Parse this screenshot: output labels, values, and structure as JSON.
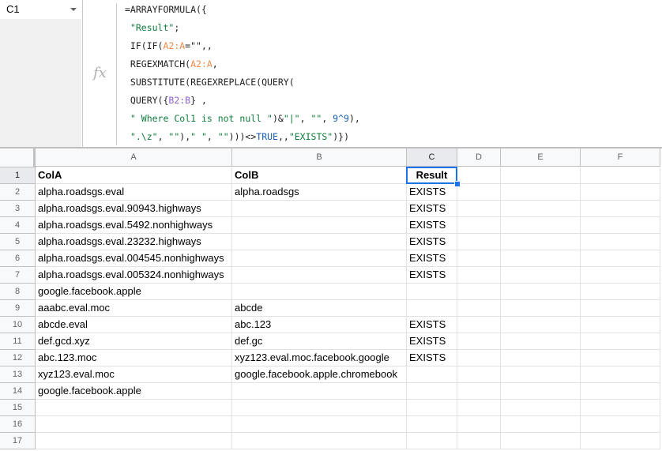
{
  "name_box": {
    "value": "C1"
  },
  "formula_bar": {
    "icon": "fx-icon",
    "lines": [
      [
        {
          "t": "=ARRAYFORMULA({",
          "c": ""
        }
      ],
      [
        {
          "t": " ",
          "c": ""
        },
        {
          "t": "\"Result\"",
          "c": "str"
        },
        {
          "t": ";",
          "c": ""
        }
      ],
      [
        {
          "t": " IF(IF(",
          "c": ""
        },
        {
          "t": "A2:A",
          "c": "ref-a"
        },
        {
          "t": "=\"\",,",
          "c": ""
        }
      ],
      [
        {
          "t": " REGEXMATCH(",
          "c": ""
        },
        {
          "t": "A2:A",
          "c": "ref-a"
        },
        {
          "t": ",",
          "c": ""
        }
      ],
      [
        {
          "t": " SUBSTITUTE(REGEXREPLACE(QUERY(",
          "c": ""
        }
      ],
      [
        {
          "t": " QUERY({",
          "c": ""
        },
        {
          "t": "B2:B",
          "c": "ref-b"
        },
        {
          "t": "} ,",
          "c": ""
        }
      ],
      [
        {
          "t": " ",
          "c": ""
        },
        {
          "t": "\" Where Col1 is not null \"",
          "c": "str"
        },
        {
          "t": ")&",
          "c": ""
        },
        {
          "t": "\"|\"",
          "c": "str"
        },
        {
          "t": ", ",
          "c": ""
        },
        {
          "t": "\"\"",
          "c": "str"
        },
        {
          "t": ", ",
          "c": ""
        },
        {
          "t": "9^9",
          "c": "num"
        },
        {
          "t": "),",
          "c": ""
        }
      ],
      [
        {
          "t": " ",
          "c": ""
        },
        {
          "t": "\".\\z\"",
          "c": "str"
        },
        {
          "t": ", ",
          "c": ""
        },
        {
          "t": "\"\"",
          "c": "str"
        },
        {
          "t": "),",
          "c": ""
        },
        {
          "t": "\" \"",
          "c": "str"
        },
        {
          "t": ", ",
          "c": ""
        },
        {
          "t": "\"\"",
          "c": "str"
        },
        {
          "t": ")))<>",
          "c": ""
        },
        {
          "t": "TRUE",
          "c": "bool"
        },
        {
          "t": ",,",
          "c": ""
        },
        {
          "t": "\"EXISTS\"",
          "c": "str"
        },
        {
          "t": ")})",
          "c": ""
        }
      ]
    ]
  },
  "columns": [
    "A",
    "B",
    "C",
    "D",
    "E",
    "F"
  ],
  "selected_cell": {
    "col": "C",
    "row": 1
  },
  "rows": [
    {
      "n": "1",
      "A": "ColA",
      "B": "ColB",
      "C": "Result"
    },
    {
      "n": "2",
      "A": "alpha.roadsgs.eval",
      "B": "alpha.roadsgs",
      "C": "EXISTS"
    },
    {
      "n": "3",
      "A": "alpha.roadsgs.eval.90943.highways",
      "B": "",
      "C": "EXISTS"
    },
    {
      "n": "4",
      "A": "alpha.roadsgs.eval.5492.nonhighways",
      "B": "",
      "C": "EXISTS"
    },
    {
      "n": "5",
      "A": "alpha.roadsgs.eval.23232.highways",
      "B": "",
      "C": "EXISTS"
    },
    {
      "n": "6",
      "A": "alpha.roadsgs.eval.004545.nonhighways",
      "B": "",
      "C": "EXISTS"
    },
    {
      "n": "7",
      "A": "alpha.roadsgs.eval.005324.nonhighways",
      "B": "",
      "C": "EXISTS"
    },
    {
      "n": "8",
      "A": "google.facebook.apple",
      "B": "",
      "C": ""
    },
    {
      "n": "9",
      "A": "aaabc.eval.moc",
      "B": "abcde",
      "C": ""
    },
    {
      "n": "10",
      "A": "abcde.eval",
      "B": "abc.123",
      "C": "EXISTS"
    },
    {
      "n": "11",
      "A": "def.gcd.xyz",
      "B": "def.gc",
      "C": "EXISTS"
    },
    {
      "n": "12",
      "A": "abc.123.moc",
      "B": "xyz123.eval.moc.facebook.google",
      "C": "EXISTS"
    },
    {
      "n": "13",
      "A": "xyz123.eval.moc",
      "B": "google.facebook.apple.chromebook",
      "C": ""
    },
    {
      "n": "14",
      "A": "google.facebook.apple",
      "B": "",
      "C": ""
    },
    {
      "n": "15",
      "A": "",
      "B": "",
      "C": ""
    },
    {
      "n": "16",
      "A": "",
      "B": "",
      "C": ""
    },
    {
      "n": "17",
      "A": "",
      "B": "",
      "C": ""
    }
  ]
}
